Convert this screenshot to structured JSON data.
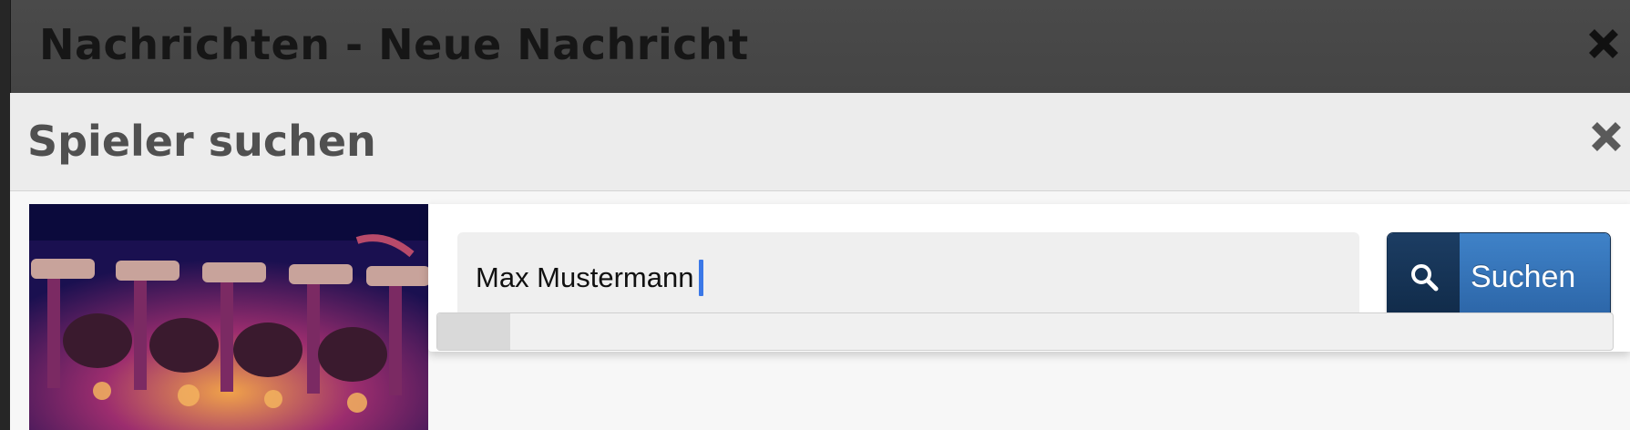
{
  "background_window": {
    "title": "Nachrichten - Neue Nachricht",
    "close_icon": "close-x-icon"
  },
  "dialog": {
    "title": "Spieler suchen",
    "close_icon": "close-x-icon",
    "banner_image": "rollercoaster-riders-photo",
    "search": {
      "value": "Max Mustermann",
      "button_icon": "magnifier-icon",
      "button_label": "Suchen"
    }
  },
  "colors": {
    "button_accent": "#3f82c8",
    "button_dark": "#102a48",
    "caret": "#3b78e7"
  }
}
